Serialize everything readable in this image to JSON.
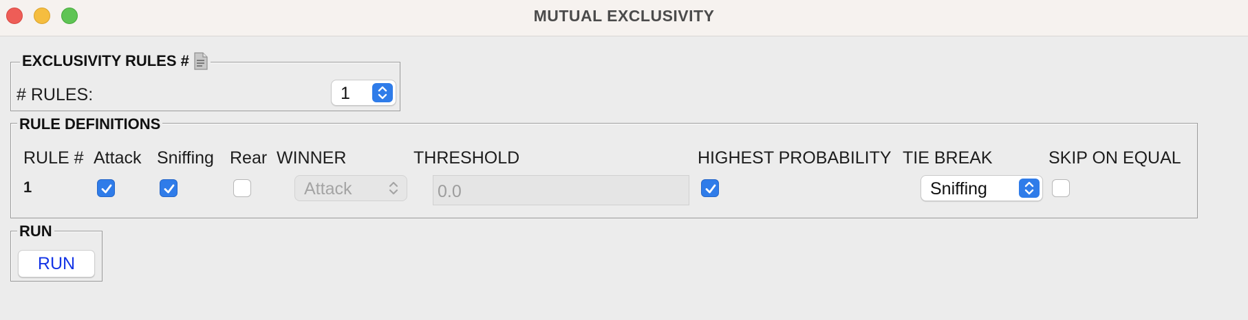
{
  "window": {
    "title": "MUTUAL EXCLUSIVITY"
  },
  "rules_group": {
    "legend": "EXCLUSIVITY RULES #",
    "legend_icon": "document-icon",
    "count_label": "# RULES:",
    "count_value": "1"
  },
  "definitions_group": {
    "legend": "RULE DEFINITIONS",
    "columns": {
      "rule": "RULE #",
      "attack": "Attack",
      "sniffing": "Sniffing",
      "rear": "Rear",
      "winner": "WINNER",
      "threshold": "THRESHOLD",
      "highest_probability": "HIGHEST PROBABILITY",
      "tie_break": "TIE BREAK",
      "skip_on_equal": "SKIP ON EQUAL"
    },
    "rows": [
      {
        "rule": "1",
        "attack": true,
        "sniffing": true,
        "rear": false,
        "winner": "Attack",
        "threshold": "0.0",
        "highest_probability": true,
        "tie_break": "Sniffing",
        "skip_on_equal": false
      }
    ]
  },
  "run_group": {
    "legend": "RUN",
    "button_label": "RUN"
  },
  "colors": {
    "accent": "#2f7ce9",
    "run_text": "#1334e6",
    "background": "#ececec"
  }
}
